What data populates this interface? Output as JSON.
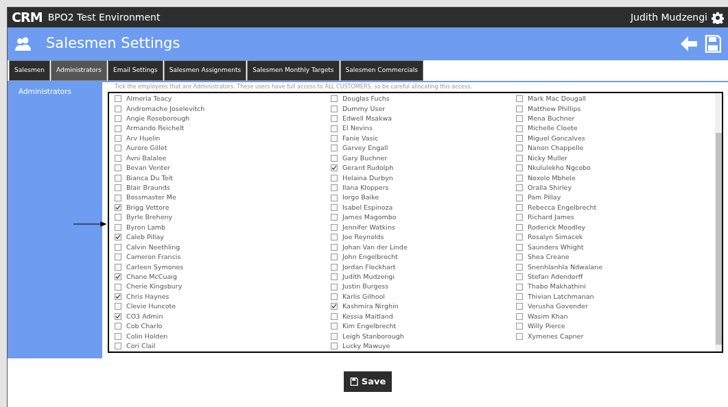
{
  "topbar": {
    "logo": "CRM",
    "title": "BPO2 Test Environment",
    "user": "Judith Mudzengi"
  },
  "header": {
    "title": "Salesmen Settings"
  },
  "tabs": [
    {
      "label": "Salesmen",
      "selected": false
    },
    {
      "label": "Administrators",
      "selected": true
    },
    {
      "label": "Email Settings",
      "selected": false
    },
    {
      "label": "Salesmen Assignments",
      "selected": false
    },
    {
      "label": "Salesmen Monthly Targets",
      "selected": false
    },
    {
      "label": "Salesmen Commercials",
      "selected": false
    }
  ],
  "sidebar": {
    "items": [
      {
        "label": "Administrators",
        "selected": true
      }
    ]
  },
  "instructions": "Tick the employees that are Administrators. These users have full access to ALL CUSTOMERS, so be careful allocating this access.",
  "employee_columns": [
    [
      {
        "name": "Almeria Teacy",
        "checked": false
      },
      {
        "name": "Andromache Joselevitch",
        "checked": false
      },
      {
        "name": "Angie Roseborough",
        "checked": false
      },
      {
        "name": "Armando Reichelt",
        "checked": false
      },
      {
        "name": "Arv Huelin",
        "checked": false
      },
      {
        "name": "Aurore Gillet",
        "checked": false
      },
      {
        "name": "Avni Balalee",
        "checked": false
      },
      {
        "name": "Bevan Venter",
        "checked": false
      },
      {
        "name": "Bianca Du Toit",
        "checked": false
      },
      {
        "name": "Blair Braunds",
        "checked": false
      },
      {
        "name": "Bossmaster Me",
        "checked": false
      },
      {
        "name": "Brigg Vettore",
        "checked": true
      },
      {
        "name": "Byrle Breheny",
        "checked": false
      },
      {
        "name": "Byron Lamb",
        "checked": false
      },
      {
        "name": "Caleb Pillay",
        "checked": true
      },
      {
        "name": "Calvin Neethling",
        "checked": false
      },
      {
        "name": "Cameron Francis",
        "checked": false
      },
      {
        "name": "Carleen Symones",
        "checked": false
      },
      {
        "name": "Chane McCuaig",
        "checked": true
      },
      {
        "name": "Cherie Kingsbury",
        "checked": false
      },
      {
        "name": "Chris Haynes",
        "checked": true
      },
      {
        "name": "Clevie Huncote",
        "checked": false
      },
      {
        "name": "CO3 Admin",
        "checked": true
      },
      {
        "name": "Cob Charlo",
        "checked": false
      },
      {
        "name": "Colin Holden",
        "checked": false
      },
      {
        "name": "Cori Clail",
        "checked": false
      }
    ],
    [
      {
        "name": "Douglas Fuchs",
        "checked": false
      },
      {
        "name": "Dummy User",
        "checked": false
      },
      {
        "name": "Edwell Msakwa",
        "checked": false
      },
      {
        "name": "El Nevins",
        "checked": false
      },
      {
        "name": "Fanie Vasic",
        "checked": false
      },
      {
        "name": "Garvey Engall",
        "checked": false
      },
      {
        "name": "Gary Buchner",
        "checked": false
      },
      {
        "name": "Gerard Rudolph",
        "checked": true
      },
      {
        "name": "Helaina Durbyn",
        "checked": false
      },
      {
        "name": "Ilana Kloppers",
        "checked": false
      },
      {
        "name": "Iorgo Baike",
        "checked": false
      },
      {
        "name": "Isabel Espinoza",
        "checked": false
      },
      {
        "name": "James Magombo",
        "checked": false
      },
      {
        "name": "Jennifer Watkins",
        "checked": false
      },
      {
        "name": "Joe Reynolds",
        "checked": false
      },
      {
        "name": "Johan Van der Linde",
        "checked": false
      },
      {
        "name": "John Engelbrecht",
        "checked": false
      },
      {
        "name": "Jordan Flockhart",
        "checked": false
      },
      {
        "name": "Judith Mudzengi",
        "checked": false
      },
      {
        "name": "Justin Burgess",
        "checked": false
      },
      {
        "name": "Karlis Gilhool",
        "checked": false
      },
      {
        "name": "Kashmira Nirghin",
        "checked": true
      },
      {
        "name": "Kessia Maitland",
        "checked": false
      },
      {
        "name": "Kim Engelbrecht",
        "checked": false
      },
      {
        "name": "Leigh Stanborough",
        "checked": false
      },
      {
        "name": "Lucky Mawuye",
        "checked": false
      }
    ],
    [
      {
        "name": "Mark Mac Dougall",
        "checked": false
      },
      {
        "name": "Matthew Phillips",
        "checked": false
      },
      {
        "name": "Mena Buchner",
        "checked": false
      },
      {
        "name": "Michelle Cloete",
        "checked": false
      },
      {
        "name": "Miguel Goncalves",
        "checked": false
      },
      {
        "name": "Nanon Chappelle",
        "checked": false
      },
      {
        "name": "Nicky Muller",
        "checked": false
      },
      {
        "name": "Nkululekho Ngcobo",
        "checked": false
      },
      {
        "name": "Noxolo Mbhele",
        "checked": false
      },
      {
        "name": "Oralla Shirley",
        "checked": false
      },
      {
        "name": "Pam Pillay",
        "checked": false
      },
      {
        "name": "Rebecca Engelbrecht",
        "checked": false
      },
      {
        "name": "Richard James",
        "checked": false
      },
      {
        "name": "Roderick Moodley",
        "checked": false
      },
      {
        "name": "Rosalyn Simacek",
        "checked": false
      },
      {
        "name": "Saunders Whight",
        "checked": false
      },
      {
        "name": "Shea Creane",
        "checked": false
      },
      {
        "name": "Snenhlanhla Ndwalane",
        "checked": false
      },
      {
        "name": "Stefan Adendorff",
        "checked": false
      },
      {
        "name": "Thabo Makhathini",
        "checked": false
      },
      {
        "name": "Thivian Latchmanan",
        "checked": false
      },
      {
        "name": "Verusha Govender",
        "checked": false
      },
      {
        "name": "Wasim Khan",
        "checked": false
      },
      {
        "name": "Willy Pierce",
        "checked": false
      },
      {
        "name": "Xymenes Capner",
        "checked": false
      }
    ]
  ],
  "save_button": "Save"
}
